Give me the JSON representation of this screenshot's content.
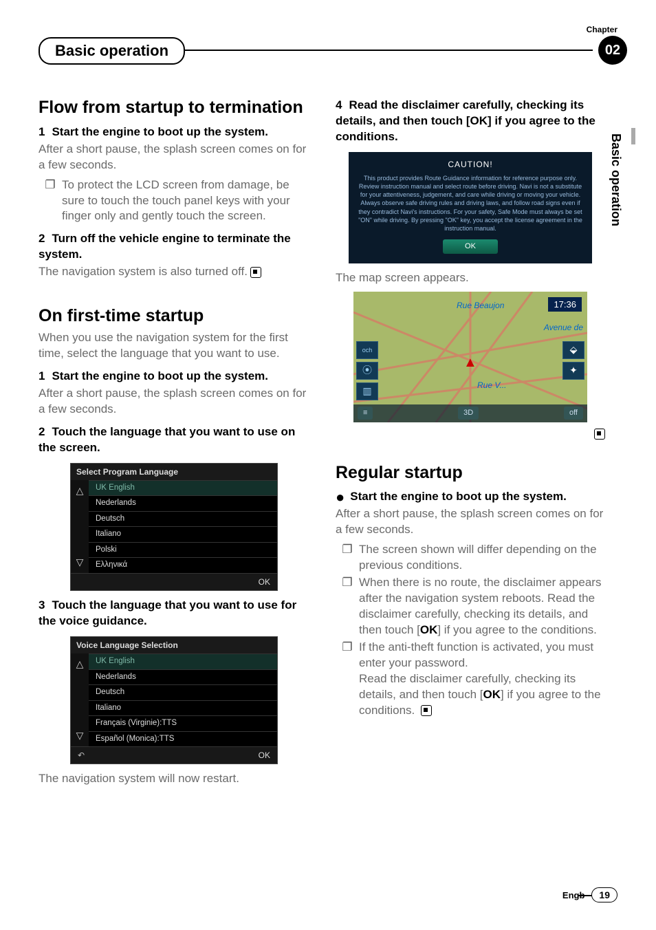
{
  "chapter": {
    "label": "Chapter",
    "number": "02"
  },
  "header": "Basic operation",
  "side_label": "Basic operation",
  "col1": {
    "h_flow": "Flow from startup to termination",
    "step1": {
      "n": "1",
      "t": "Start the engine to boot up the system."
    },
    "body1": "After a short pause, the splash screen comes on for a few seconds.",
    "bullet1": "To protect the LCD screen from damage, be sure to touch the touch panel keys with your finger only and gently touch the screen.",
    "step2": {
      "n": "2",
      "t": "Turn off the vehicle engine to terminate the system."
    },
    "body2": "The navigation system is also turned off.",
    "h_first": "On first-time startup",
    "first_intro": "When you use the navigation system for the first time, select the language that you want to use.",
    "f_step1": {
      "n": "1",
      "t": "Start the engine to boot up the system."
    },
    "f_body1": "After a short pause, the splash screen comes on for a few seconds.",
    "f_step2": {
      "n": "2",
      "t": "Touch the language that you want to use on the screen."
    },
    "lang_title": "Select Program Language",
    "lang_items": [
      "UK English",
      "Nederlands",
      "Deutsch",
      "Italiano",
      "Polski",
      "Ελληνικά"
    ],
    "lang_ok": "OK",
    "f_step3": {
      "n": "3",
      "t": "Touch the language that you want to use for the voice guidance."
    },
    "voice_title": "Voice Language Selection",
    "voice_items": [
      "UK English",
      "Nederlands",
      "Deutsch",
      "Italiano",
      "Français (Virginie):TTS",
      "Español (Monica):TTS"
    ],
    "voice_ok": "OK",
    "restart": "The navigation system will now restart."
  },
  "col2": {
    "step4": {
      "n": "4",
      "t": "Read the disclaimer carefully, checking its details, and then touch [OK] if you agree to the conditions."
    },
    "caution_title": "CAUTION!",
    "caution_body": "This product provides Route Guidance information for reference purpose only. Review instruction manual and select route before driving. Navi is not a substitute for your attentiveness, judgement, and care while driving or moving your vehicle. Always observe safe driving rules and driving laws, and follow road signs even if they contradict Navi's instructions. For your safety, Safe Mode must always be set \"ON\" while driving. By pressing \"OK\" key, you accept the license agreement in the instruction manual.",
    "caution_ok": "OK",
    "map_appears": "The map screen appears.",
    "map": {
      "street1": "Rue Beaujon",
      "street2": "Avenue de",
      "street3": "Rue V...",
      "time": "17:36",
      "left_label": "och",
      "bottom_right": "off",
      "bottom_3d": "3D"
    },
    "h_regular": "Regular startup",
    "r_step": "Start the engine to boot up the system.",
    "r_body": "After a short pause, the splash screen comes on for a few seconds.",
    "r_b1": "The screen shown will differ depending on the previous conditions.",
    "r_b2a": "When there is no route, the disclaimer appears after the navigation system reboots. Read the disclaimer carefully, checking its details, and then touch [",
    "r_b2_ok": "OK",
    "r_b2b": "] if you agree to the conditions.",
    "r_b3a": "If the anti-theft function is activated, you must enter your password.",
    "r_b3b": "Read the disclaimer carefully, checking its details, and then touch [",
    "r_b3_ok": "OK",
    "r_b3c": "] if you agree to the conditions."
  },
  "footer": {
    "lang": "Engb",
    "page": "19"
  }
}
